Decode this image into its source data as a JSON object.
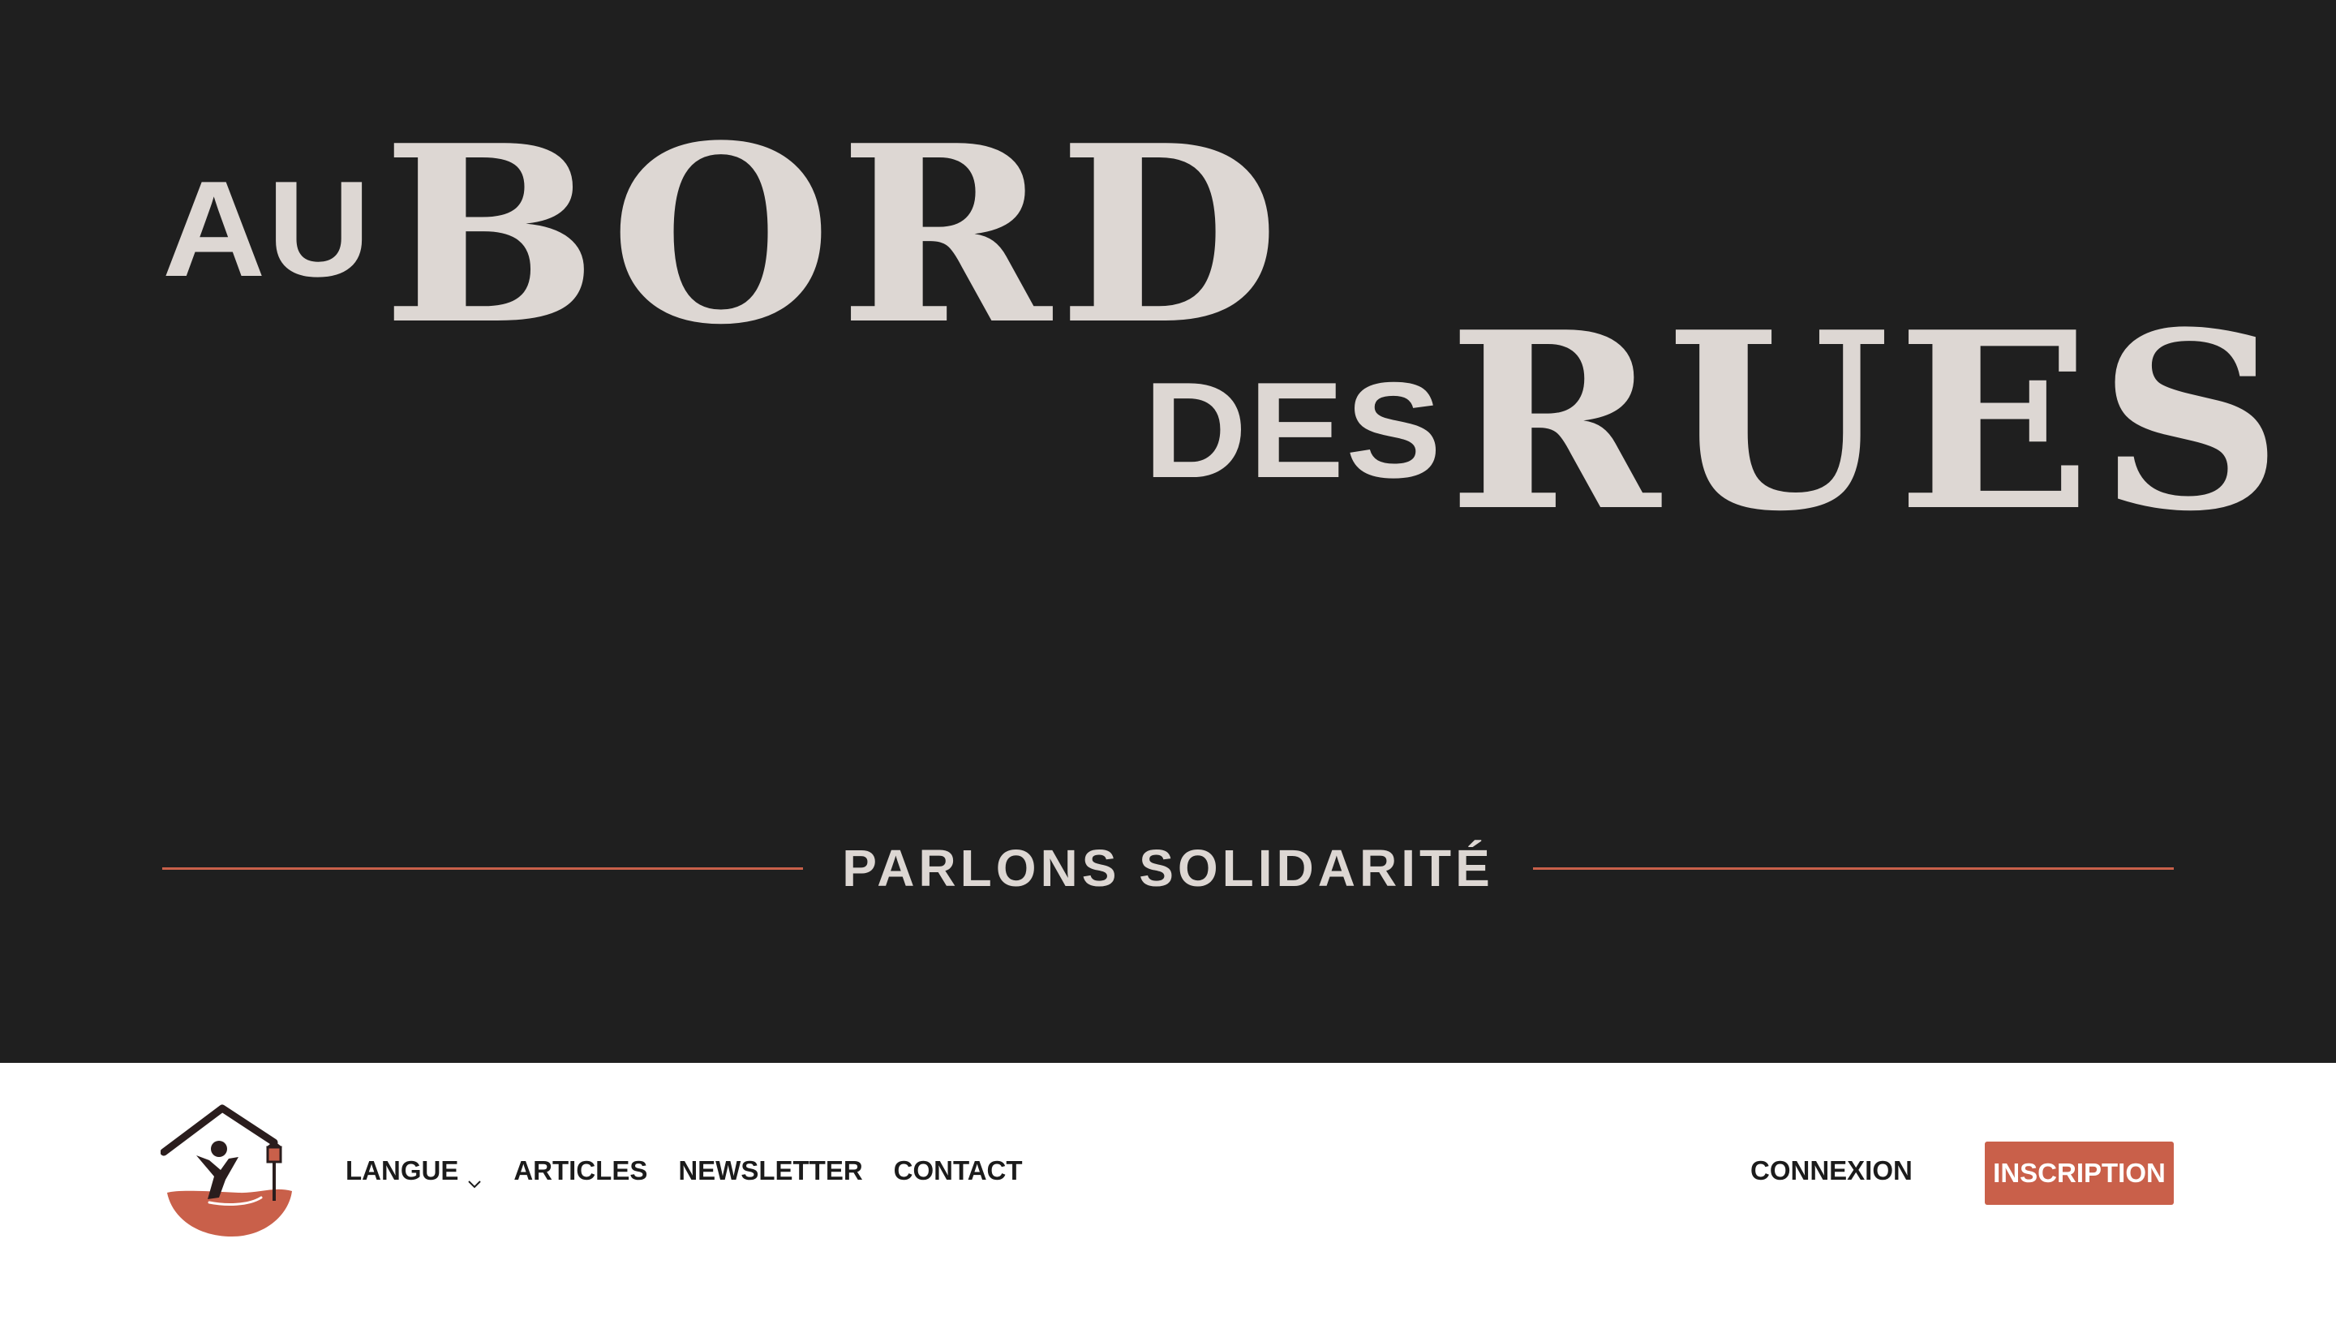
{
  "hero": {
    "title_line1_small": "AU",
    "title_line1_big": "BORD",
    "title_line2_small": "DES",
    "title_line2_big": "RUES",
    "tagline": "PARLONS SOLIDARITÉ"
  },
  "nav": {
    "logo_icon": "home-hand-figure-logo",
    "links": [
      {
        "label": "LANGUE",
        "has_dropdown": true
      },
      {
        "label": "ARTICLES"
      },
      {
        "label": "NEWSLETTER"
      },
      {
        "label": "CONTACT"
      }
    ],
    "login_label": "CONNEXION",
    "signup_label": "INSCRIPTION"
  },
  "colors": {
    "hero_background": "#1f1f1f",
    "title_text": "#ddd7d3",
    "accent": "#c9604a",
    "nav_background": "#ffffff",
    "nav_text": "#1b1b1b",
    "logo_dark": "#2a1d1d"
  }
}
